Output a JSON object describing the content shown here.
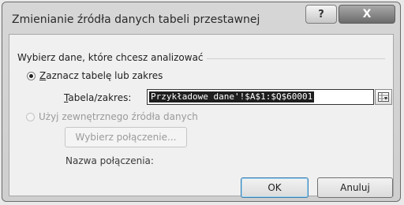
{
  "dialog": {
    "title": "Zmienianie źródła danych tabeli przestawnej",
    "help_glyph": "?",
    "close_glyph": "X"
  },
  "group": {
    "label": "Wybierz dane, które chcesz analizować"
  },
  "option_table": {
    "label_u": "Z",
    "label_rest": "aznacz tabelę lub zakres",
    "selected": true
  },
  "range_field": {
    "label_u": "T",
    "label_rest": "abela/zakres:",
    "value": "Przykładowe dane'!$A$1:$Q$60001"
  },
  "option_external": {
    "label": "Użyj zewnętrznego źródła danych",
    "selected": false
  },
  "choose_connection": {
    "label": "Wybierz połączenie..."
  },
  "connection_name": {
    "label": "Nazwa połączenia:"
  },
  "buttons": {
    "ok": "OK",
    "cancel": "Anuluj"
  }
}
